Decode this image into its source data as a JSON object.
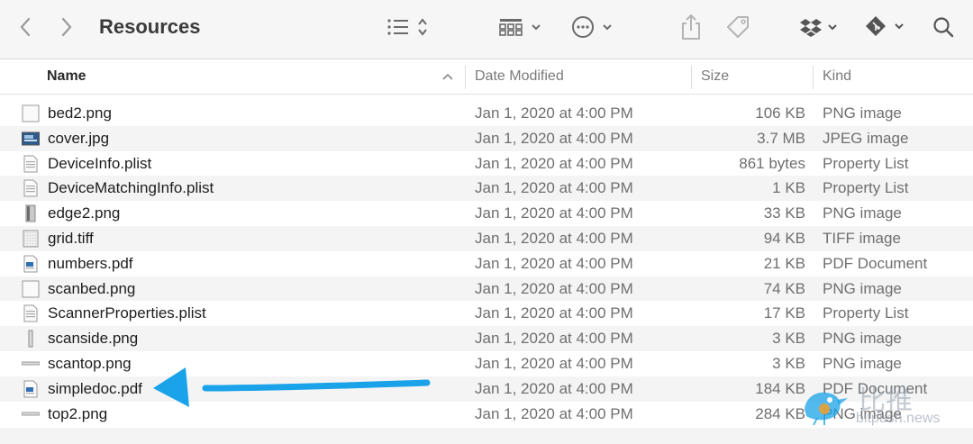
{
  "window": {
    "title": "Resources"
  },
  "toolbar": {
    "back_icon": "chevron-left-icon",
    "forward_icon": "chevron-right-icon",
    "view_icon": "list-view-icon",
    "group_icon": "grid-group-icon",
    "action_icon": "more-circle-icon",
    "share_icon": "share-icon",
    "tag_icon": "tag-icon",
    "dropbox_icon": "dropbox-icon",
    "git_icon": "git-diamond-icon",
    "search_icon": "search-icon"
  },
  "columns": {
    "name": "Name",
    "date": "Date Modified",
    "size": "Size",
    "kind": "Kind"
  },
  "files": [
    {
      "name": "bed2.png",
      "date": "Jan 1, 2020 at 4:00 PM",
      "size": "106 KB",
      "kind": "PNG image",
      "icon": "blank-image-icon"
    },
    {
      "name": "cover.jpg",
      "date": "Jan 1, 2020 at 4:00 PM",
      "size": "3.7 MB",
      "kind": "JPEG image",
      "icon": "photo-thumb-icon"
    },
    {
      "name": "DeviceInfo.plist",
      "date": "Jan 1, 2020 at 4:00 PM",
      "size": "861 bytes",
      "kind": "Property List",
      "icon": "plist-doc-icon"
    },
    {
      "name": "DeviceMatchingInfo.plist",
      "date": "Jan 1, 2020 at 4:00 PM",
      "size": "1 KB",
      "kind": "Property List",
      "icon": "plist-doc-icon"
    },
    {
      "name": "edge2.png",
      "date": "Jan 1, 2020 at 4:00 PM",
      "size": "33 KB",
      "kind": "PNG image",
      "icon": "edge-image-icon"
    },
    {
      "name": "grid.tiff",
      "date": "Jan 1, 2020 at 4:00 PM",
      "size": "94 KB",
      "kind": "TIFF image",
      "icon": "grid-image-icon"
    },
    {
      "name": "numbers.pdf",
      "date": "Jan 1, 2020 at 4:00 PM",
      "size": "21 KB",
      "kind": "PDF Document",
      "icon": "pdf-doc-icon"
    },
    {
      "name": "scanbed.png",
      "date": "Jan 1, 2020 at 4:00 PM",
      "size": "74 KB",
      "kind": "PNG image",
      "icon": "blank-image-icon"
    },
    {
      "name": "ScannerProperties.plist",
      "date": "Jan 1, 2020 at 4:00 PM",
      "size": "17 KB",
      "kind": "Property List",
      "icon": "plist-doc-icon"
    },
    {
      "name": "scanside.png",
      "date": "Jan 1, 2020 at 4:00 PM",
      "size": "3 KB",
      "kind": "PNG image",
      "icon": "thin-image-icon"
    },
    {
      "name": "scantop.png",
      "date": "Jan 1, 2020 at 4:00 PM",
      "size": "3 KB",
      "kind": "PNG image",
      "icon": "line-image-icon"
    },
    {
      "name": "simpledoc.pdf",
      "date": "Jan 1, 2020 at 4:00 PM",
      "size": "184 KB",
      "kind": "PDF Document",
      "icon": "pdf-doc-icon"
    },
    {
      "name": "top2.png",
      "date": "Jan 1, 2020 at 4:00 PM",
      "size": "284 KB",
      "kind": "PNG image",
      "icon": "line-image-icon"
    }
  ],
  "annotation": {
    "arrow_color": "#1aa3e8",
    "target": "simpledoc.pdf"
  },
  "watermark": {
    "text_cn": "比推",
    "url": "bitpush.news"
  }
}
